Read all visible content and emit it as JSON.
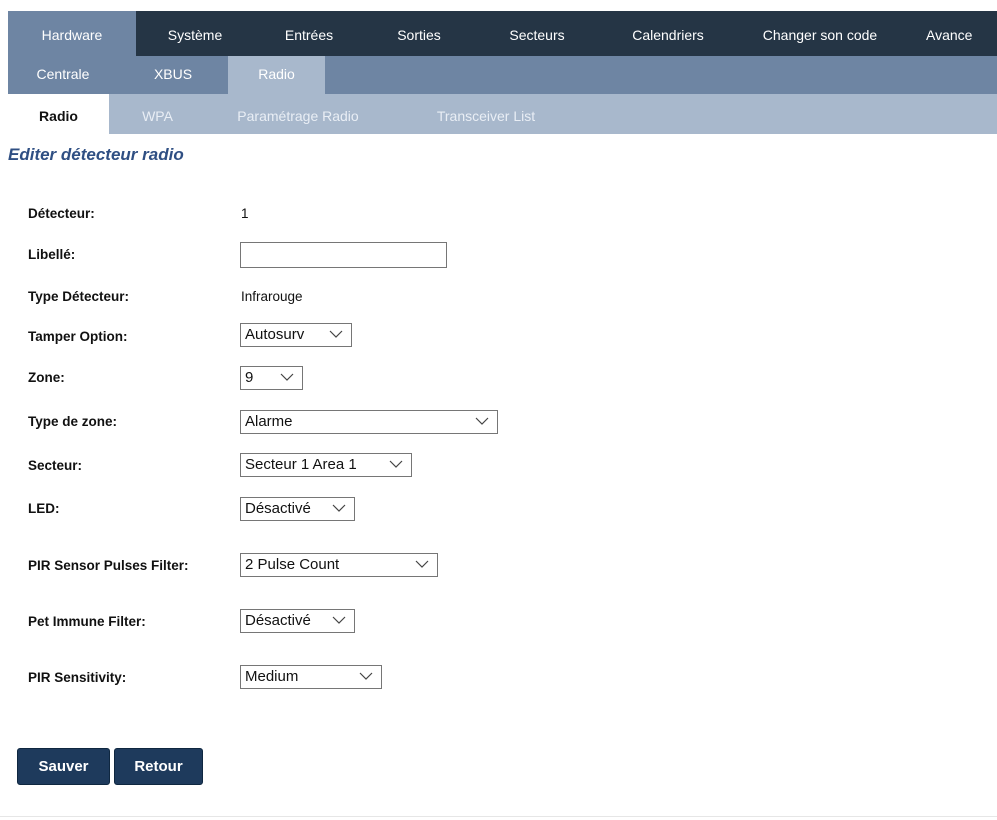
{
  "nav": {
    "primary": [
      "Hardware",
      "Système",
      "Entrées",
      "Sorties",
      "Secteurs",
      "Calendriers",
      "Changer son code",
      "Avance"
    ],
    "secondary": [
      "Centrale",
      "XBUS",
      "Radio"
    ],
    "tertiary": [
      "Radio",
      "WPA",
      "Paramétrage Radio",
      "Transceiver List"
    ]
  },
  "page_title": "Editer détecteur radio",
  "form": {
    "detecteur": {
      "label": "Détecteur:",
      "value": "1"
    },
    "libelle": {
      "label": "Libellé:",
      "value": ""
    },
    "type_detecteur": {
      "label": "Type Détecteur:",
      "value": "Infrarouge"
    },
    "tamper": {
      "label": "Tamper Option:",
      "value": "Autosurv"
    },
    "zone": {
      "label": "Zone:",
      "value": "9"
    },
    "type_zone": {
      "label": "Type de zone:",
      "value": "Alarme"
    },
    "secteur": {
      "label": "Secteur:",
      "value": "Secteur 1 Area 1"
    },
    "led": {
      "label": "LED:",
      "value": "Désactivé"
    },
    "pir_pulses": {
      "label": "PIR Sensor Pulses Filter:",
      "value": "2 Pulse Count"
    },
    "pet_immune": {
      "label": "Pet Immune Filter:",
      "value": "Désactivé"
    },
    "pir_sensitivity": {
      "label": "PIR Sensitivity:",
      "value": "Medium"
    }
  },
  "buttons": {
    "save": "Sauver",
    "back": "Retour"
  },
  "colors": {
    "nav_dark": "#253545",
    "nav_mid": "#6e85a3",
    "nav_light": "#a8b8cc",
    "title": "#2f4f83",
    "button": "#1e3a5c"
  }
}
